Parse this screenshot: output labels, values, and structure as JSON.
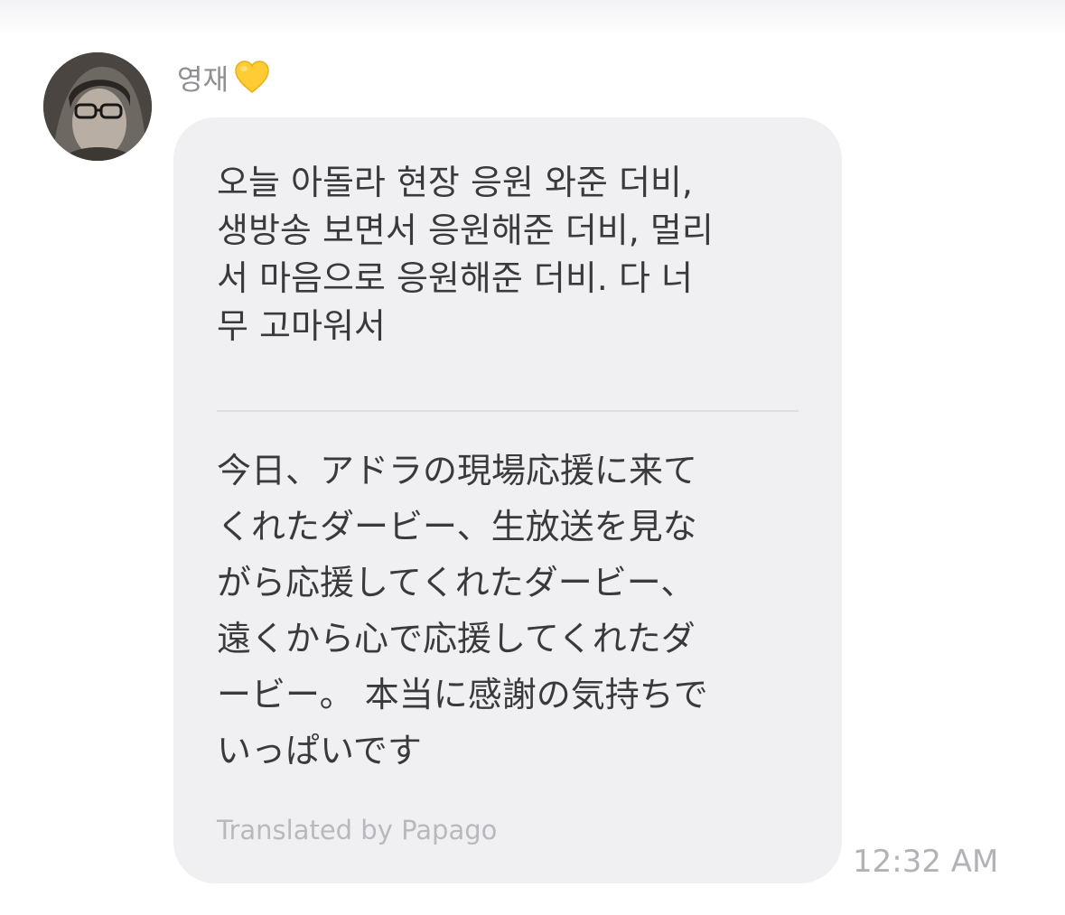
{
  "conversation": {
    "sender": {
      "name": "영재",
      "emoji_icon": "yellow-heart-icon",
      "avatar_icon": "profile-photo"
    },
    "message": {
      "original_text": "오늘 아돌라 현장 응원 와준 더비,\n생방송 보면서 응원해준 더비, 멀리\n서 마음으로 응원해준 더비. 다 너\n무 고마워서",
      "translated_text": "今日、アドラの現場応援に来て\nくれたダービー、生放送を見な\nがら応援してくれたダービー、\n遠くから心で応援してくれたダ\nービー。 本当に感謝の気持ちで\nいっぱいです",
      "translation_credit": "Translated by Papago",
      "timestamp": "12:32 AM"
    }
  },
  "colors": {
    "bubble_background": "#f0f0f3",
    "message_text": "#3a3a3c",
    "secondary_text": "#8e8e93",
    "heart": "#ffcc33"
  }
}
